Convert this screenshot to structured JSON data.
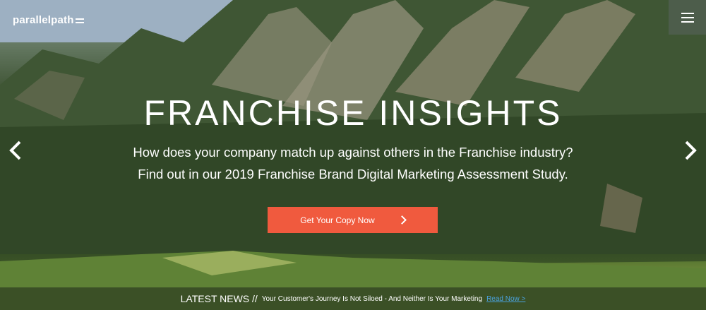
{
  "header": {
    "logo_text": "parallelpath",
    "menu_icon": "hamburger-menu-icon"
  },
  "hero": {
    "headline": "FRANCHISE INSIGHTS",
    "subline_1": "How does your company match up against others in the Franchise industry?",
    "subline_2": "Find out in our 2019 Franchise Brand Digital Marketing Assessment Study.",
    "cta_label": "Get Your Copy Now",
    "prev_icon": "chevron-left-icon",
    "next_icon": "chevron-right-icon"
  },
  "news": {
    "label": "LATEST NEWS //",
    "headline": "Your Customer's Journey Is Not Siloed - And Neither Is Your Marketing",
    "link_text": "Read Now >"
  },
  "colors": {
    "cta": "#f05a3e",
    "link": "#4aa3df"
  }
}
